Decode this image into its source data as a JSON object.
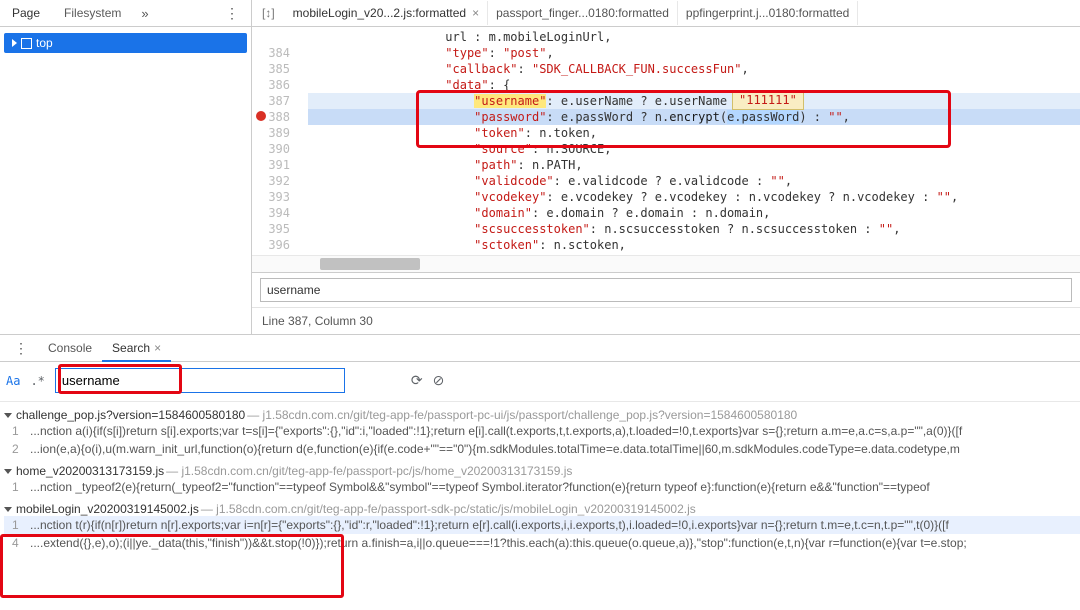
{
  "left": {
    "tabs": [
      "Page",
      "Filesystem"
    ],
    "more": "»",
    "kebab": "⋮",
    "tree": {
      "root": "top"
    }
  },
  "fileTabs": {
    "bracket": "[↕]",
    "items": [
      {
        "label": "mobileLogin_v20...2.js:formatted",
        "active": true
      },
      {
        "label": "passport_finger...0180:formatted",
        "active": false
      },
      {
        "label": "ppfingerprint.j...0180:formatted",
        "active": false
      }
    ]
  },
  "code": {
    "lines": [
      {
        "n": "",
        "html": "                   url : m.mobileLoginUrl,"
      },
      {
        "n": "384",
        "html": "                   <span class='k'>\"type\"</span>: <span class='k'>\"post\"</span>,"
      },
      {
        "n": "385",
        "html": "                   <span class='k'>\"callback\"</span>: <span class='k'>\"SDK_CALLBACK_FUN.successFun\"</span>,"
      },
      {
        "n": "386",
        "html": "                   <span class='k'>\"data\"</span>: {"
      },
      {
        "n": "387",
        "html": "                       <span class='k prop-hl'>\"username\"</span>: e.userName ? e.userName : \"\" ,",
        "hl": true
      },
      {
        "n": "388",
        "html": "                       <span class='k'>\"password\"</span>: e.passWord ? n.<span class='fn'>encrypt</span>(<span class='sel-txt'>e.passWord</span>) : <span class='k'>\"\"</span>,",
        "exec": true
      },
      {
        "n": "389",
        "html": "                       <span class='k'>\"token\"</span>: n.token,"
      },
      {
        "n": "390",
        "html": "                       <span class='k'>\"source\"</span>: n.SOURCE,"
      },
      {
        "n": "391",
        "html": "                       <span class='k'>\"path\"</span>: n.PATH,"
      },
      {
        "n": "392",
        "html": "                       <span class='k'>\"validcode\"</span>: e.validcode ? e.validcode : <span class='k'>\"\"</span>,"
      },
      {
        "n": "393",
        "html": "                       <span class='k'>\"vcodekey\"</span>: e.vcodekey ? e.vcodekey : n.vcodekey ? n.vcodekey : <span class='k'>\"\"</span>,"
      },
      {
        "n": "394",
        "html": "                       <span class='k'>\"domain\"</span>: e.domain ? e.domain : n.domain,"
      },
      {
        "n": "395",
        "html": "                       <span class='k'>\"scsuccesstoken\"</span>: n.scsuccesstoken ? n.scsuccesstoken : <span class='k'>\"\"</span>,"
      },
      {
        "n": "396",
        "html": "                       <span class='k'>\"sctoken\"</span>: n.sctoken,"
      },
      {
        "n": "397",
        "html": " "
      }
    ],
    "tooltip": "\"111111\""
  },
  "find": {
    "value": "username"
  },
  "status": {
    "text": "Line 387, Column 30"
  },
  "drawer": {
    "tabs": [
      "Console",
      "Search"
    ],
    "activeIdx": 1,
    "searchValue": "username",
    "refresh": "⟳",
    "clear": "⊘",
    "results": [
      {
        "name": "challenge_pop.js?version=1584600580180",
        "path": "— j1.58cdn.com.cn/git/teg-app-fe/passport-pc-ui/js/passport/challenge_pop.js?version=1584600580180",
        "lines": [
          {
            "n": "1",
            "t": "...nction a(i){if(s[i])return s[i].exports;var t=s[i]={\"exports\":{},\"id\":i,\"loaded\":!1};return e[i].call(t.exports,t,t.exports,a),t.loaded=!0,t.exports}var s={};return a.m=e,a.c=s,a.p=\"\",a(0)}([f"
          },
          {
            "n": "2",
            "t": "...ion(e,a){o(i),u(m.warn_init_url,function(o){return d(e,function(e){if(e.code+\"\"==\"0\"){m.sdkModules.totalTime=e.data.totalTime||60,m.sdkModules.codeType=e.data.codetype,m"
          }
        ]
      },
      {
        "name": "home_v20200313173159.js",
        "path": "— j1.58cdn.com.cn/git/teg-app-fe/passport-pc/js/home_v20200313173159.js",
        "lines": [
          {
            "n": "1",
            "t": "...nction _typeof2(e){return(_typeof2=\"function\"==typeof Symbol&&\"symbol\"==typeof Symbol.iterator?function(e){return typeof e}:function(e){return e&&\"function\"==typeof"
          }
        ]
      },
      {
        "name": "mobileLogin_v20200319145002.js",
        "path": "— j1.58cdn.com.cn/git/teg-app-fe/passport-sdk-pc/static/js/mobileLogin_v20200319145002.js",
        "lines": [
          {
            "n": "1",
            "t": "...nction t(r){if(n[r])return n[r].exports;var i=n[r]={\"exports\":{},\"id\":r,\"loaded\":!1};return e[r].call(i.exports,i,i.exports,t),i.loaded=!0,i.exports}var n={};return t.m=e,t.c=n,t.p=\"\",t(0)}([f",
            "sel": true
          },
          {
            "n": "4",
            "t": "....extend({},e),o);(i||ye._data(this,\"finish\"))&&t.stop(!0)});return a.finish=a,i||o.queue===!1?this.each(a):this.queue(o.queue,a)},\"stop\":function(e,t,n){var r=function(e){var t=e.stop;"
          }
        ]
      }
    ]
  }
}
